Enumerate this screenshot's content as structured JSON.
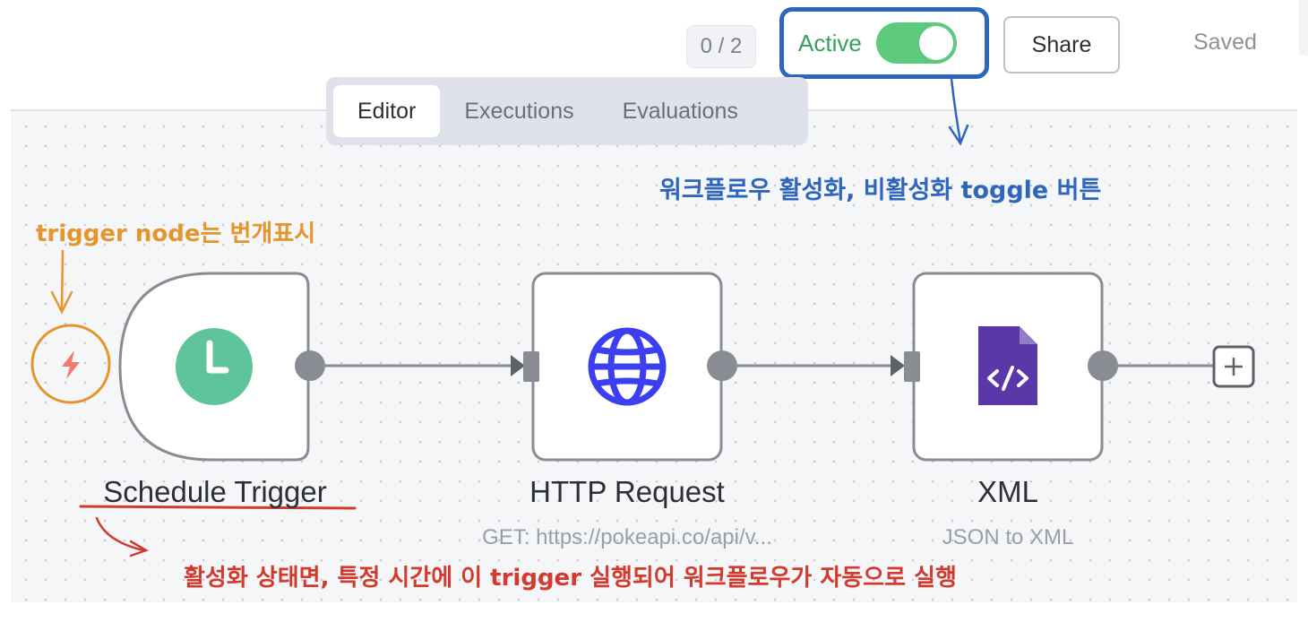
{
  "header": {
    "counter": "0 / 2",
    "active_label": "Active",
    "share_label": "Share",
    "saved_label": "Saved"
  },
  "tabs": [
    {
      "label": "Editor",
      "active": true
    },
    {
      "label": "Executions",
      "active": false
    },
    {
      "label": "Evaluations",
      "active": false
    }
  ],
  "nodes": [
    {
      "title": "Schedule Trigger",
      "subtitle": "",
      "icon": "clock-icon",
      "color": "#5ec49b"
    },
    {
      "title": "HTTP Request",
      "subtitle": "GET: https://pokeapi.co/api/v...",
      "icon": "globe-icon",
      "color": "#3b3ff0"
    },
    {
      "title": "XML",
      "subtitle": "JSON to XML",
      "icon": "xml-file-icon",
      "color": "#5a38a8"
    }
  ],
  "annotations": {
    "toggle_note": "워크플로우 활성화, 비활성화 toggle 버튼",
    "trigger_note": "trigger node는 번개표시",
    "schedule_note": "활성화 상태면, 특정 시간에 이 trigger 실행되어 워크플로우가 자동으로 실행"
  },
  "colors": {
    "toggle_on": "#5dc97b",
    "highlight_blue": "#2f66bd",
    "annotation_orange": "#e5952b",
    "annotation_red": "#d23a2e",
    "bolt": "#f07a6b"
  }
}
